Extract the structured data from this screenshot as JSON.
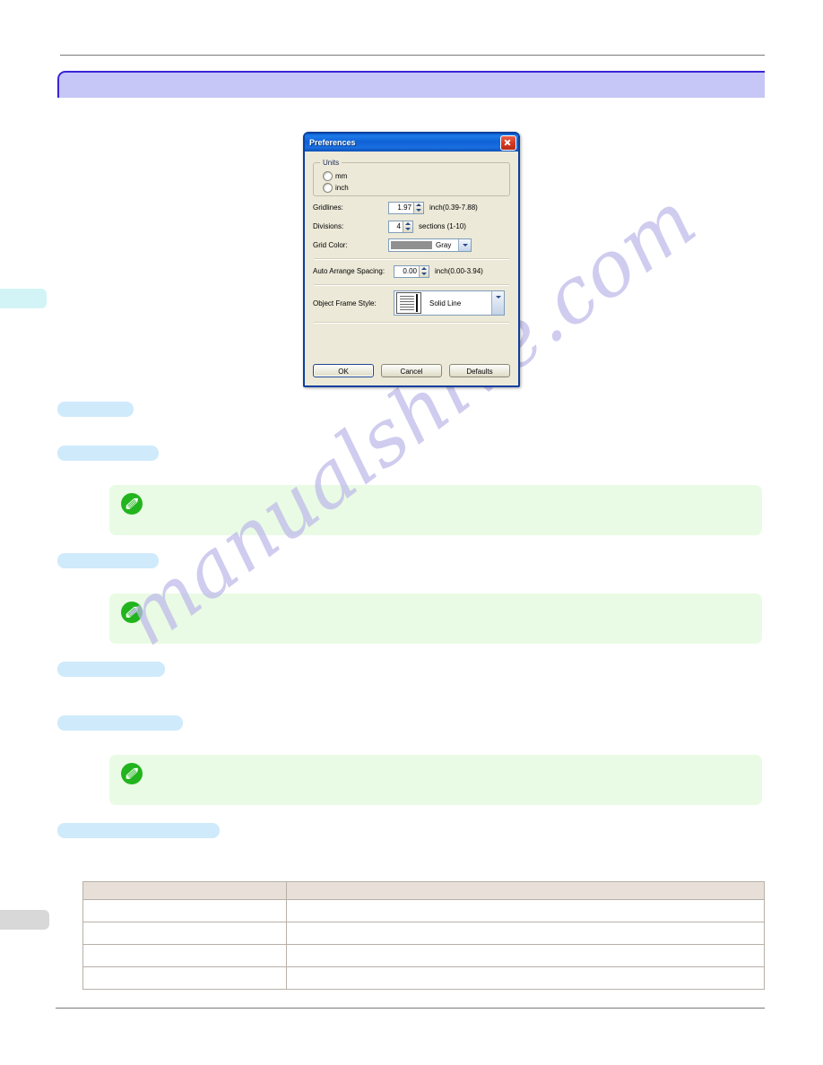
{
  "page": {
    "background": "#ffffff",
    "watermark_text": "manualshive.com",
    "watermark_color": "#bdb9ea",
    "chapter_banner_color": "#c6c6f7",
    "chapter_banner_border": "#3a24d8",
    "heading_bar_color": "#cfeafb",
    "note_box_color": "#e9fbe4",
    "note_icon_color": "#22b41e",
    "margin_tab_color": "#d3f4f7",
    "margin_tab_lower_color": "#d8d8d8"
  },
  "dialog": {
    "title": "Preferences",
    "titlebar_color": "#0f62d6",
    "close_button_color": "#d83a22",
    "body_color": "#ece9d8",
    "units": {
      "legend": "Units",
      "options": [
        {
          "label": "mm",
          "selected": false
        },
        {
          "label": "inch",
          "selected": false
        }
      ]
    },
    "gridlines": {
      "label": "Gridlines:",
      "value": "1.97",
      "hint": "inch(0.39-7.88)"
    },
    "divisions": {
      "label": "Divisions:",
      "value": "4",
      "hint": "sections (1-10)"
    },
    "grid_color": {
      "label": "Grid Color:",
      "value": "Gray",
      "swatch": "#909090"
    },
    "auto_arrange_spacing": {
      "label": "Auto Arrange Spacing:",
      "value": "0.00",
      "hint": "inch(0.00-3.94)"
    },
    "object_frame_style": {
      "label": "Object Frame Style:",
      "value": "Solid Line"
    },
    "buttons": {
      "ok": "OK",
      "cancel": "Cancel",
      "defaults": "Defaults"
    }
  },
  "spec_table": {
    "headers": [
      "",
      ""
    ],
    "rows": [
      [
        "",
        ""
      ],
      [
        "",
        ""
      ],
      [
        "",
        ""
      ],
      [
        "",
        ""
      ]
    ],
    "header_bg": "#e8e0d8",
    "border_color": "#b7b0a8"
  }
}
